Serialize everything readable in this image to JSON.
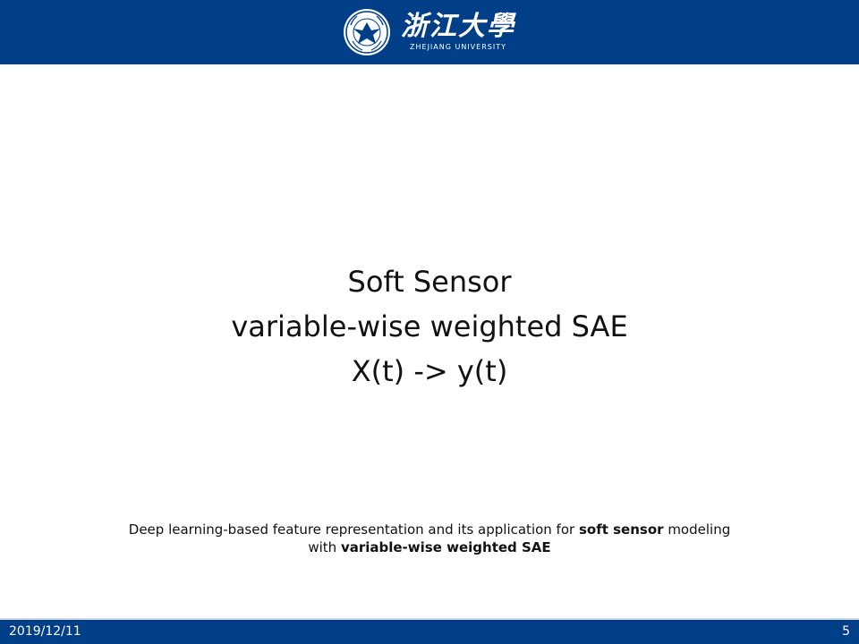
{
  "header": {
    "university_name_cn": "浙江大學",
    "university_name_en": "ZHEJIANG UNIVERSITY",
    "seal_icon": "zju-seal-icon",
    "color": "#003f88"
  },
  "slide": {
    "title_lines": [
      "Soft Sensor",
      "variable-wise weighted SAE",
      "X(t) -> y(t)"
    ],
    "caption": {
      "part1": "Deep learning-based feature representation and its application for ",
      "bold1": "soft sensor",
      "part2": " modeling with ",
      "bold2": "variable-wise weighted SAE"
    }
  },
  "footer": {
    "date": "2019/12/11",
    "page_number": "5"
  }
}
